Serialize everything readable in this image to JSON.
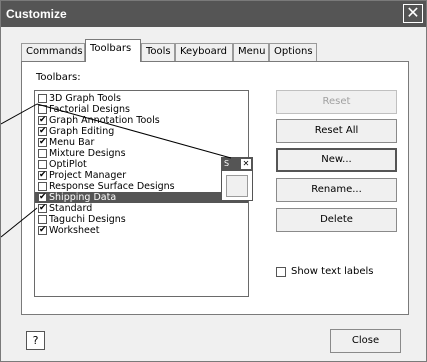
{
  "window": {
    "title": "Customize",
    "close_glyph": "✕"
  },
  "tabs": [
    {
      "label": "Commands"
    },
    {
      "label": "Toolbars",
      "active": true
    },
    {
      "label": "Tools"
    },
    {
      "label": "Keyboard"
    },
    {
      "label": "Menu"
    },
    {
      "label": "Options"
    }
  ],
  "toolbars_label": "Toolbars:",
  "toolbars": [
    {
      "label": "3D Graph Tools",
      "checked": false
    },
    {
      "label": "Factorial Designs",
      "checked": false
    },
    {
      "label": "Graph Annotation Tools",
      "checked": true
    },
    {
      "label": "Graph Editing",
      "checked": true
    },
    {
      "label": "Menu Bar",
      "checked": true
    },
    {
      "label": "Mixture Designs",
      "checked": false
    },
    {
      "label": "OptiPlot",
      "checked": false
    },
    {
      "label": "Project Manager",
      "checked": true
    },
    {
      "label": "Response Surface Designs",
      "checked": false
    },
    {
      "label": "Shipping Data",
      "checked": true,
      "selected": true
    },
    {
      "label": "Standard",
      "checked": true
    },
    {
      "label": "Taguchi Designs",
      "checked": false
    },
    {
      "label": "Worksheet",
      "checked": true
    }
  ],
  "buttons": {
    "reset": "Reset",
    "reset_all": "Reset All",
    "new": "New...",
    "rename": "Rename...",
    "delete": "Delete"
  },
  "show_text_labels": {
    "label": "Show text labels",
    "checked": false
  },
  "floating_toolbar": {
    "title": "S",
    "close_glyph": "✕"
  },
  "help_glyph": "?",
  "close_button": "Close",
  "check_glyph": "✔",
  "colors": {
    "titlebar": "#555555",
    "selection": "#555555"
  }
}
